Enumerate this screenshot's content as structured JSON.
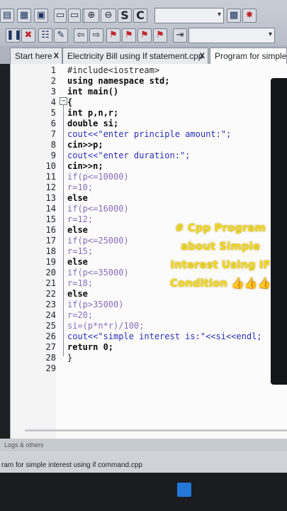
{
  "toolbar": {
    "icons_row1": [
      "open-file-icon",
      "save-icon",
      "print-icon",
      "window-icon",
      "window-icon",
      "window-icon",
      "zoom-in-icon",
      "zoom-out-icon",
      "search-icon",
      "compile-icon",
      "tools-icon",
      "wrench-icon"
    ],
    "s_label": "S",
    "c_label": "C",
    "combo1_value": "",
    "combo2_value": "",
    "icons_row2": [
      "pause-icon",
      "stop-icon",
      "toggle-icon",
      "format-icon",
      "back-arrow-icon",
      "forward-arrow-icon",
      "flag-icon",
      "bookmark-icon",
      "bookmark-icon",
      "bookmark-icon",
      "run-icon"
    ]
  },
  "tabs": [
    {
      "label": "Start here",
      "close": "X"
    },
    {
      "label": "Electricity Bill using If statement.cpp",
      "close": "X"
    },
    {
      "label": "Program for simple",
      "close": ""
    }
  ],
  "editor": {
    "line_numbers": [
      "1",
      "2",
      "3",
      "4",
      "5",
      "6",
      "7",
      "8",
      "9",
      "10",
      "11",
      "12",
      "13",
      "14",
      "15",
      "16",
      "17",
      "18",
      "19",
      "20",
      "21",
      "22",
      "23",
      "24",
      "25",
      "26",
      "27",
      "28",
      "29"
    ],
    "fold_marker": "−",
    "lines": [
      "#include<iostream>",
      "using namespace std;",
      "int main()",
      "{",
      "int p,n,r;",
      "double si;",
      "cout<<\"enter principle amount:\";",
      "cin>>p;",
      "cout<<\"enter duration:\";",
      "cin>>n;",
      "if(p<=10000)",
      "r=10;",
      "else",
      "if(p<=16000)",
      "r=12;",
      "else",
      "if(p<=25000)",
      "r=15;",
      "else",
      "if(p<=35000)",
      "r=18;",
      "else",
      "if(p>35000)",
      "r=20;",
      "si=(p*n*r)/100;",
      "cout<<\"simple interest is:\"<<si<<endl;",
      "return 0;",
      "}",
      ""
    ]
  },
  "caption": {
    "line1": "# Cpp Program",
    "line2": "about Simple",
    "line3": "Interest Using IF",
    "line4": "Condition 👍👍👍"
  },
  "statusbar": {
    "text": "Logs & others"
  },
  "footer": {
    "path": "ram for simple interest using if command.cpp"
  }
}
